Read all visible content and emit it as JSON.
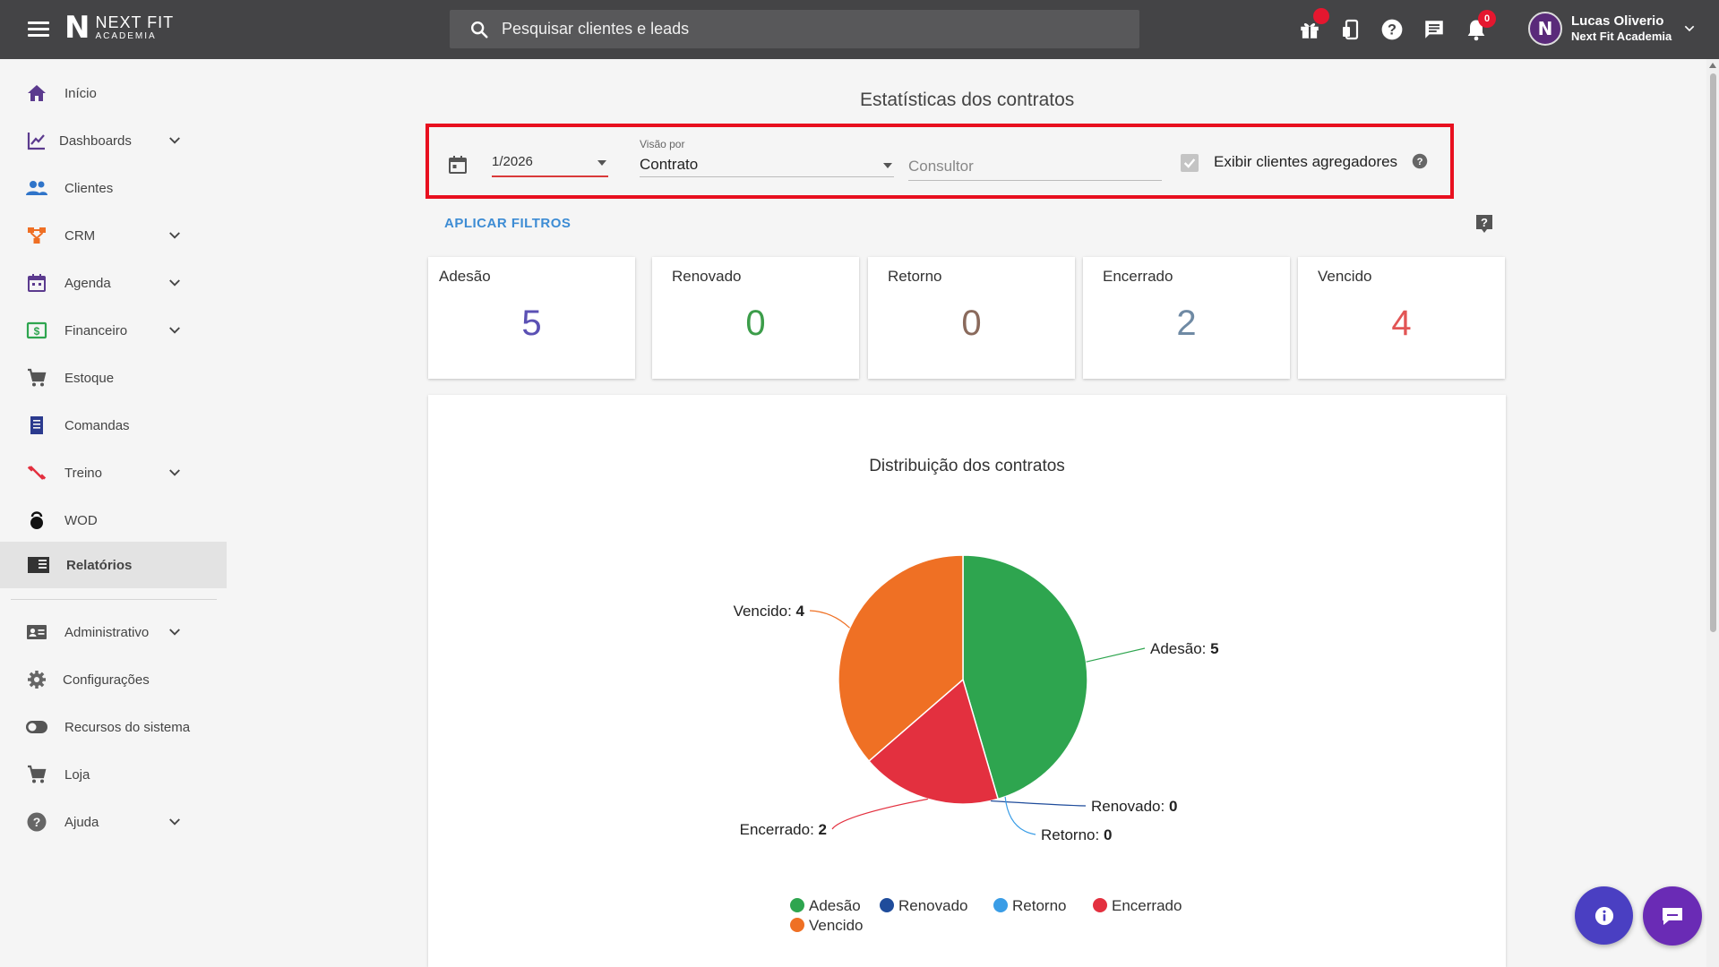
{
  "topbar": {
    "logo_line1": "NEXT FIT",
    "logo_line2": "ACADEMIA",
    "search_placeholder": "Pesquisar clientes e leads",
    "notifications_count": "0",
    "user_name": "Lucas Oliverio",
    "user_company": "Next Fit Academia"
  },
  "sidebar": {
    "items": [
      {
        "label": "Início",
        "icon": "home-icon"
      },
      {
        "label": "Dashboards",
        "icon": "chart-line-icon"
      },
      {
        "label": "Clientes",
        "icon": "people-icon"
      },
      {
        "label": "CRM",
        "icon": "crm-icon"
      },
      {
        "label": "Agenda",
        "icon": "calendar-icon"
      },
      {
        "label": "Financeiro",
        "icon": "money-icon"
      },
      {
        "label": "Estoque",
        "icon": "cart-icon"
      },
      {
        "label": "Comandas",
        "icon": "receipt-icon"
      },
      {
        "label": "Treino",
        "icon": "dumbbell-icon"
      },
      {
        "label": "WOD",
        "icon": "kettlebell-icon"
      },
      {
        "label": "Relatórios",
        "icon": "report-icon"
      },
      {
        "label": "Administrativo",
        "icon": "id-card-icon"
      },
      {
        "label": "Configurações",
        "icon": "gear-icon"
      },
      {
        "label": "Recursos do sistema",
        "icon": "toggle-icon"
      },
      {
        "label": "Loja",
        "icon": "cart-icon"
      },
      {
        "label": "Ajuda",
        "icon": "help-icon"
      }
    ]
  },
  "main": {
    "title": "Estatísticas dos contratos",
    "filters": {
      "date_value": "1/2026",
      "view_label": "Visão por",
      "view_value": "Contrato",
      "consultant_placeholder": "Consultor",
      "show_aggregators_label": "Exibir clientes agregadores"
    },
    "apply_label": "APLICAR FILTROS",
    "stats": [
      {
        "label": "Adesão",
        "value": "5",
        "color": "#5b51b4"
      },
      {
        "label": "Renovado",
        "value": "0",
        "color": "#3c9d4a"
      },
      {
        "label": "Retorno",
        "value": "0",
        "color": "#8a6a5c"
      },
      {
        "label": "Encerrado",
        "value": "2",
        "color": "#6f8aa4"
      },
      {
        "label": "Vencido",
        "value": "4",
        "color": "#e25555"
      }
    ]
  },
  "chart_data": {
    "type": "pie",
    "title": "Distribuição dos contratos",
    "categories": [
      "Adesão",
      "Renovado",
      "Retorno",
      "Encerrado",
      "Vencido"
    ],
    "values": [
      5,
      0,
      0,
      2,
      4
    ],
    "colors": [
      "#2ea54f",
      "#1f4c9b",
      "#3a9de6",
      "#e3303f",
      "#ef7024"
    ],
    "legend_position": "bottom"
  }
}
